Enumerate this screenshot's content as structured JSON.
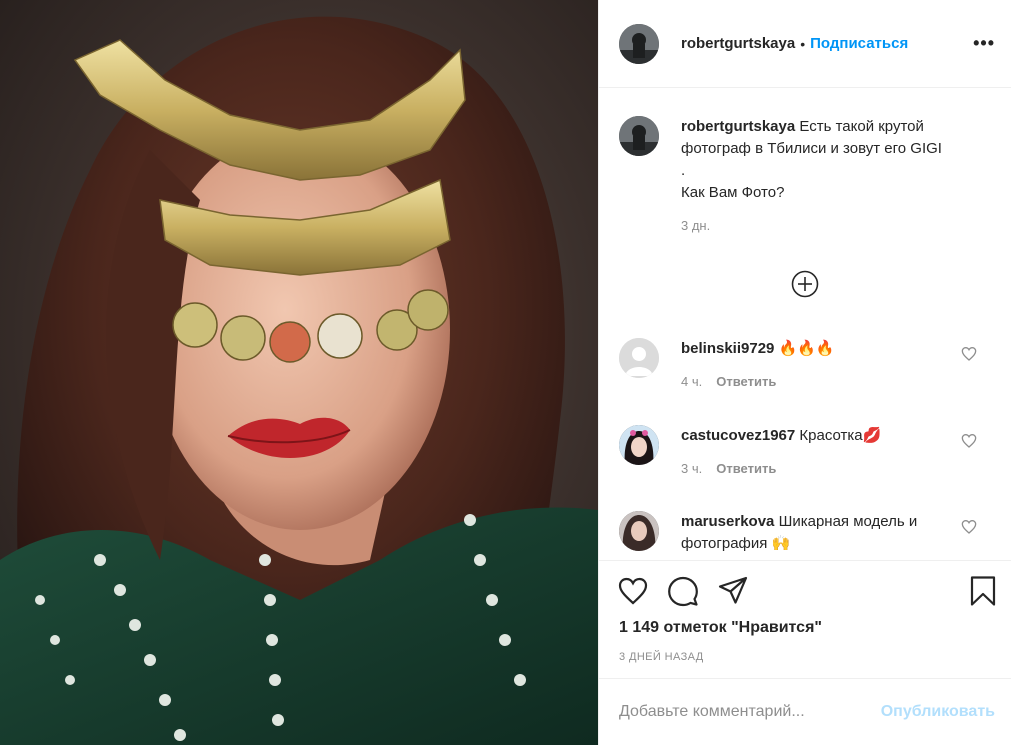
{
  "post": {
    "author": "robertgurtskaya",
    "separator": "•",
    "follow_label": "Подписаться",
    "more_icon": "more-icon",
    "more_label": "•••"
  },
  "caption": {
    "username": "robertgurtskaya",
    "line1": "Есть такой крутой фотограф в Тбилиси и зовут его GIGI",
    "line2": ".",
    "line3": "Как Вам Фото?",
    "time": "3 дн."
  },
  "load_more_icon": "plus-circle-icon",
  "comments": [
    {
      "username": "belinskii9729",
      "text": "🔥🔥🔥",
      "time": "4 ч.",
      "reply": "Ответить"
    },
    {
      "username": "castucovez1967",
      "text": "Красотка💋",
      "time": "3 ч.",
      "reply": "Ответить"
    },
    {
      "username": "maruserkova",
      "text": "Шикарная модель и фотография 🙌",
      "time": "",
      "reply": ""
    }
  ],
  "actions": {
    "like_icon": "heart-icon",
    "comment_icon": "comment-icon",
    "share_icon": "send-icon",
    "save_icon": "bookmark-icon"
  },
  "likes_text": "1 149 отметок \"Нравится\"",
  "posted_ago": "3 ДНЕЙ НАЗАД",
  "add_comment": {
    "placeholder": "Добавьте комментарий...",
    "post_label": "Опубликовать"
  },
  "colors": {
    "link": "#0095f6",
    "post_disabled": "#b2dffc",
    "secondary_text": "#8e8e8e",
    "border": "#efefef"
  }
}
